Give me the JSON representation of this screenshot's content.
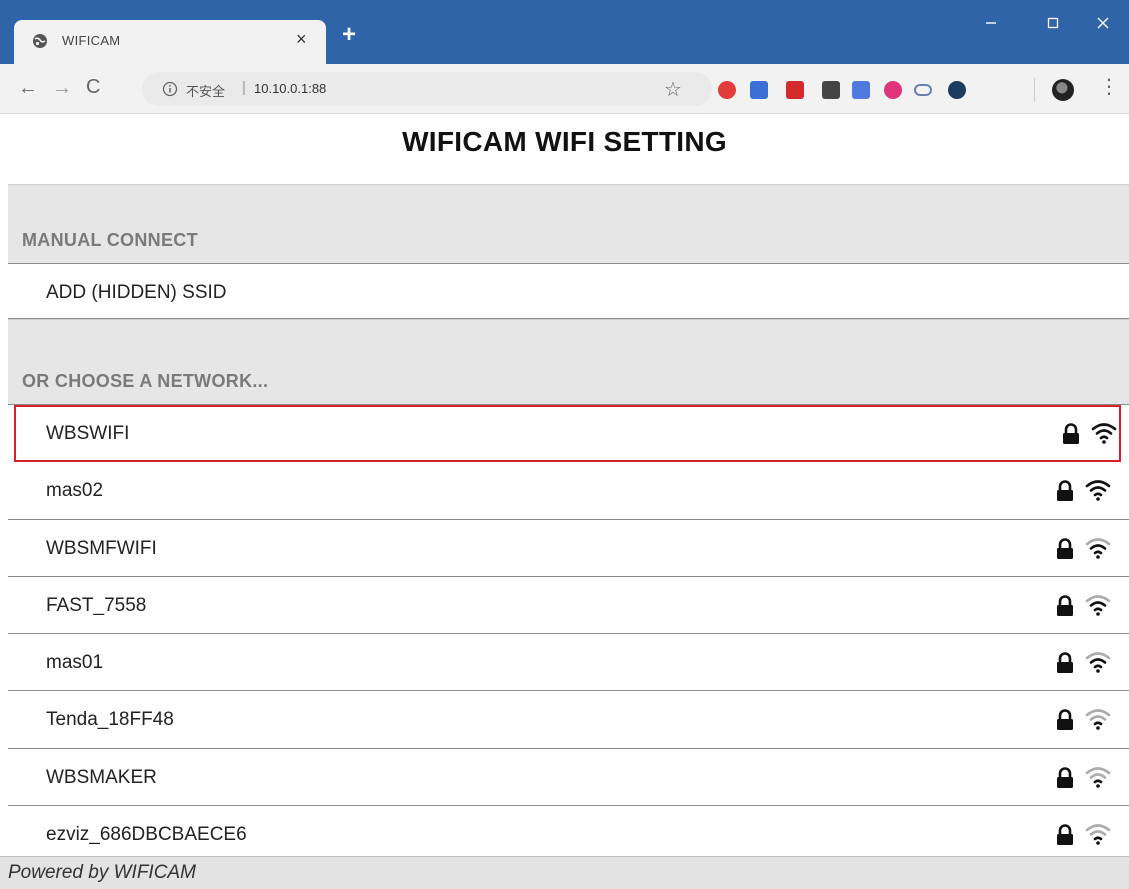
{
  "browser": {
    "tab_title": "WIFICAM",
    "tab_close": "×",
    "new_tab": "+",
    "insecure_label": "不安全",
    "url_separator": "|",
    "url": "10.10.0.1:88",
    "extension_icons": [
      {
        "name": "ext-red-round-icon",
        "color": "#e23b3b"
      },
      {
        "name": "ext-translate-icon",
        "color": "#3a6fd8"
      },
      {
        "name": "ext-red-square-icon",
        "color": "#d32b2b"
      },
      {
        "name": "ext-badge-icon",
        "color": "#444444"
      },
      {
        "name": "ext-blue-chevron-icon",
        "color": "#4f7be0"
      },
      {
        "name": "ext-pink-eye-icon",
        "color": "#e0337a"
      },
      {
        "name": "ext-cloud-icon",
        "color": "#6a7fb8"
      },
      {
        "name": "ext-dark-circle-icon",
        "color": "#1d3d5e"
      }
    ]
  },
  "page": {
    "title": "WIFICAM WIFI SETTING",
    "manual_section_label": "MANUAL CONNECT",
    "add_hidden_ssid": "ADD (HIDDEN) SSID",
    "choose_section_label": "OR CHOOSE A NETWORK...",
    "networks": [
      {
        "ssid": "WBSWIFI",
        "secured": true,
        "signal": "strong",
        "selected": true
      },
      {
        "ssid": "mas02",
        "secured": true,
        "signal": "strong",
        "selected": false
      },
      {
        "ssid": "WBSMFWIFI",
        "secured": true,
        "signal": "medium",
        "selected": false
      },
      {
        "ssid": "FAST_7558",
        "secured": true,
        "signal": "medium",
        "selected": false
      },
      {
        "ssid": "mas01",
        "secured": true,
        "signal": "medium",
        "selected": false
      },
      {
        "ssid": "Tenda_18FF48",
        "secured": true,
        "signal": "weak",
        "selected": false
      },
      {
        "ssid": "WBSMAKER",
        "secured": true,
        "signal": "weak",
        "selected": false
      },
      {
        "ssid": "ezviz_686DBCBAECE6",
        "secured": true,
        "signal": "weak",
        "selected": false
      }
    ],
    "footer": "Powered by WIFICAM"
  },
  "colors": {
    "titlebar": "#2f64a9",
    "selection_outline": "#d9202a",
    "section_band": "#e6e6e6",
    "section_label": "#7a7a7a"
  }
}
